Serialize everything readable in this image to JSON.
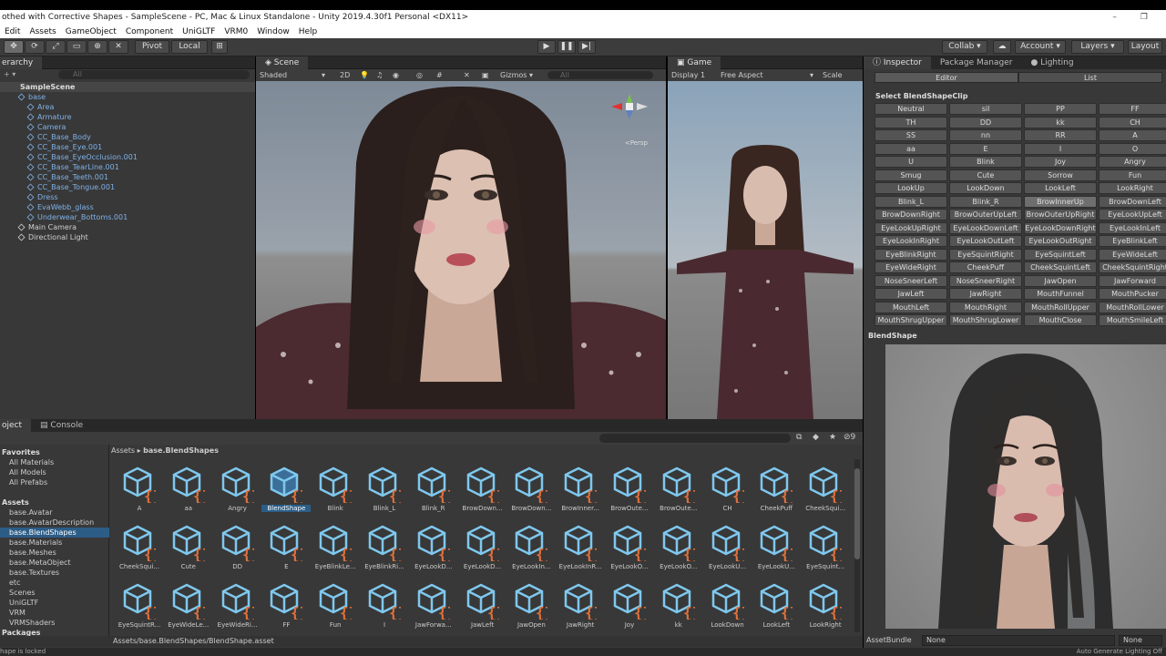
{
  "window": {
    "title": "othed with Corrective Shapes - SampleScene - PC, Mac & Linux Standalone - Unity 2019.4.30f1 Personal <DX11>"
  },
  "menu": [
    "Edit",
    "Assets",
    "GameObject",
    "Component",
    "UniGLTF",
    "VRM0",
    "Window",
    "Help"
  ],
  "toolbar": {
    "pivot": "Pivot",
    "local": "Local",
    "collab": "Collab",
    "account": "Account",
    "layers": "Layers",
    "layout": "Layout"
  },
  "hierarchy": {
    "tab": "erarchy",
    "search_placeholder": "All",
    "scene": "SampleScene",
    "items": [
      {
        "label": "base",
        "indent": 1,
        "color": "blue"
      },
      {
        "label": "Area",
        "indent": 2,
        "color": "blue"
      },
      {
        "label": "Armature",
        "indent": 2,
        "color": "blue"
      },
      {
        "label": "Camera",
        "indent": 2,
        "color": "blue"
      },
      {
        "label": "CC_Base_Body",
        "indent": 2,
        "color": "blue"
      },
      {
        "label": "CC_Base_Eye.001",
        "indent": 2,
        "color": "blue"
      },
      {
        "label": "CC_Base_EyeOcclusion.001",
        "indent": 2,
        "color": "blue"
      },
      {
        "label": "CC_Base_TearLine.001",
        "indent": 2,
        "color": "blue"
      },
      {
        "label": "CC_Base_Teeth.001",
        "indent": 2,
        "color": "blue"
      },
      {
        "label": "CC_Base_Tongue.001",
        "indent": 2,
        "color": "blue"
      },
      {
        "label": "Dress",
        "indent": 2,
        "color": "blue"
      },
      {
        "label": "EvaWebb_glass",
        "indent": 2,
        "color": "blue"
      },
      {
        "label": "Underwear_Bottoms.001",
        "indent": 2,
        "color": "blue"
      },
      {
        "label": "Main Camera",
        "indent": 1,
        "color": "white"
      },
      {
        "label": "Directional Light",
        "indent": 1,
        "color": "white"
      }
    ]
  },
  "scene": {
    "tab": "Scene",
    "shading": "Shaded",
    "mode2d": "2D",
    "gizmos": "Gizmos",
    "search_placeholder": "All",
    "persp": "<Persp"
  },
  "game": {
    "tab": "Game",
    "display": "Display 1",
    "aspect": "Free Aspect",
    "scale": "Scale"
  },
  "inspector": {
    "tabs": [
      "Inspector",
      "Package Manager",
      "Lighting"
    ],
    "modes": [
      "Editor",
      "List"
    ],
    "select_label": "Select BlendShapeClip",
    "clips": [
      "Neutral",
      "sil",
      "PP",
      "FF",
      "TH",
      "DD",
      "kk",
      "CH",
      "SS",
      "nn",
      "RR",
      "A",
      "aa",
      "E",
      "I",
      "O",
      "U",
      "Blink",
      "Joy",
      "Angry",
      "Smug",
      "Cute",
      "Sorrow",
      "Fun",
      "LookUp",
      "LookDown",
      "LookLeft",
      "LookRight",
      "Blink_L",
      "Blink_R",
      "BrowInnerUp",
      "BrowDownLeft",
      "BrowDownRight",
      "BrowOuterUpLeft",
      "BrowOuterUpRight",
      "EyeLookUpLeft",
      "EyeLookUpRight",
      "EyeLookDownLeft",
      "EyeLookDownRight",
      "EyeLookInLeft",
      "EyeLookInRight",
      "EyeLookOutLeft",
      "EyeLookOutRight",
      "EyeBlinkLeft",
      "EyeBlinkRight",
      "EyeSquintRight",
      "EyeSquintLeft",
      "EyeWideLeft",
      "EyeWideRight",
      "CheekPuff",
      "CheekSquintLeft",
      "CheekSquintRight",
      "NoseSneerLeft",
      "NoseSneerRight",
      "JawOpen",
      "JawForward",
      "JawLeft",
      "JawRight",
      "MouthFunnel",
      "MouthPucker",
      "MouthLeft",
      "MouthRight",
      "MouthRollUpper",
      "MouthRollLower",
      "MouthShrugUpper",
      "MouthShrugLower",
      "MouthClose",
      "MouthSmileLeft"
    ],
    "highlighted_clip": "BrowInnerUp",
    "blendshape_label": "BlendShape",
    "asset_bundle_label": "AssetBundle",
    "asset_bundle_value": "None",
    "asset_bundle_variant": "None"
  },
  "project": {
    "tabs": [
      "oject",
      "Console"
    ],
    "hidden_count": "9",
    "favorites": {
      "title": "Favorites",
      "items": [
        "All Materials",
        "All Models",
        "All Prefabs"
      ]
    },
    "assets": {
      "title": "Assets",
      "items": [
        "base.Avatar",
        "base.AvatarDescription",
        "base.BlendShapes",
        "base.Materials",
        "base.Meshes",
        "base.MetaObject",
        "base.Textures",
        "etc",
        "Scenes",
        "UniGLTF",
        "VRM",
        "VRMShaders"
      ],
      "selected": "base.BlendShapes"
    },
    "packages": "Packages",
    "breadcrumb": {
      "root": "Assets",
      "sep": "▸",
      "current": "base.BlendShapes"
    },
    "asset_items": [
      "A",
      "aa",
      "Angry",
      "BlendShape",
      "Blink",
      "Blink_L",
      "Blink_R",
      "BrowDown...",
      "BrowDown...",
      "BrowInner...",
      "BrowOute...",
      "BrowOute...",
      "CH",
      "CheekPuff",
      "CheekSqui...",
      "CheekSqui...",
      "Cute",
      "DD",
      "E",
      "EyeBlinkLe...",
      "EyeBlinkRi...",
      "EyeLookD...",
      "EyeLookD...",
      "EyeLookIn...",
      "EyeLookInR...",
      "EyeLookO...",
      "EyeLookO...",
      "EyeLookU...",
      "EyeLookU...",
      "EyeSquint...",
      "EyeSquintR...",
      "EyeWideLe...",
      "EyeWideRi...",
      "FF",
      "Fun",
      "I",
      "JawForwa...",
      "JawLeft",
      "JawOpen",
      "JawRight",
      "Joy",
      "kk",
      "LookDown",
      "LookLeft",
      "LookRight"
    ],
    "selected_asset": "BlendShape",
    "status_path": "Assets/base.BlendShapes/BlendShape.asset"
  },
  "statusbar": {
    "left": "hape is locked",
    "right": "Auto Generate Lighting Off"
  }
}
